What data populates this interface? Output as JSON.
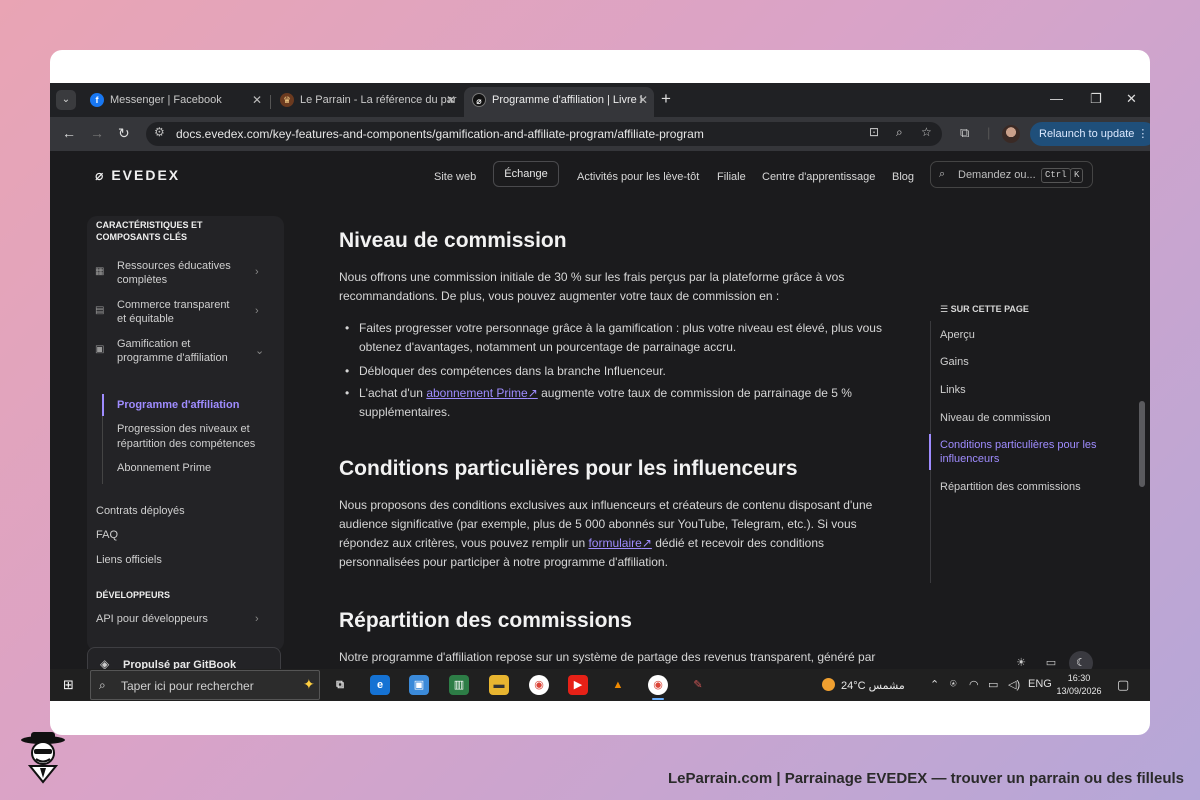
{
  "browser": {
    "tabs": [
      {
        "label": "Messenger | Facebook",
        "favicon": "facebook-icon"
      },
      {
        "label": "Le Parrain - La référence du par",
        "favicon": "leparrain-icon"
      },
      {
        "label": "Programme d'affiliation | Livre l",
        "favicon": "evedex-icon"
      }
    ],
    "url": "docs.evedex.com/key-features-and-components/gamification-and-affiliate-program/affiliate-program",
    "relaunch_label": "Relaunch to update"
  },
  "site": {
    "logo": "EVEDEX",
    "nav": [
      "Site web",
      "Échange",
      "Activités pour les lève-tôt",
      "Filiale",
      "Centre d'apprentissage",
      "Blog"
    ],
    "search_placeholder": "Demandez ou...",
    "search_kbd": [
      "Ctrl",
      "K"
    ]
  },
  "sidebar": {
    "section1": "CARACTÉRISTIQUES ET COMPOSANTS CLÉS",
    "items": [
      "Ressources éducatives complètes",
      "Commerce transparent et équitable",
      "Gamification et programme d'affiliation"
    ],
    "sub_items": [
      "Programme d'affiliation",
      "Progression des niveaux et répartition des compétences",
      "Abonnement Prime"
    ],
    "plain": [
      "Contrats déployés",
      "FAQ",
      "Liens officiels"
    ],
    "section2": "DÉVELOPPEURS",
    "dev_items": [
      "API pour développeurs"
    ],
    "gitbook": "Propulsé par GitBook"
  },
  "content": {
    "h_commission": "Niveau de commission",
    "p_commission": "Nous offrons une commission initiale de 30 % sur les frais perçus par la plateforme grâce à vos recommandations. De plus, vous pouvez augmenter votre taux de commission en :",
    "bullet1": "Faites progresser votre personnage grâce à la gamification : plus votre niveau est élevé, plus vous obtenez d'avantages, notamment un pourcentage de parrainage accru.",
    "bullet2": "Débloquer des compétences dans la branche Influenceur.",
    "bullet3_pre": "L'achat d'un",
    "bullet3_link": "abonnement Prime",
    "bullet3_post": "augmente votre taux de commission de parrainage de 5 % supplémentaires.",
    "h_influencers": "Conditions particulières pour les influenceurs",
    "p_infl_pre": "Nous proposons des conditions exclusives aux influenceurs et créateurs de contenu disposant d'une audience significative (par exemple, plus de 5 000 abonnés sur YouTube, Telegram, etc.). Si vous répondez aux critères, vous pouvez remplir un",
    "p_infl_link": "formulaire",
    "p_infl_post": "dédié et recevoir des conditions personnalisées pour participer à notre programme d'affiliation.",
    "h_repartition": "Répartition des commissions",
    "p_repartition": "Notre programme d'affiliation repose sur un système de partage des revenus transparent, généré par chaque transaction effectuée sur la plateforme. Il est important de comprendre comment ces revenus sont générés et répartis entre l'utilisateur, les affiliés et la plateforme."
  },
  "toc": {
    "title": "SUR CETTE PAGE",
    "items": [
      "Aperçu",
      "Gains",
      "Links",
      "Niveau de commission",
      "Conditions particulières pour les influenceurs",
      "Répartition des commissions"
    ]
  },
  "taskbar": {
    "search_placeholder": "Taper ici pour rechercher",
    "weather": "24°C  مشمس",
    "lang": "ENG",
    "time": "16:30",
    "date": "13/09/2026"
  },
  "watermark": "LeParrain.com | Parrainage EVEDEX — trouver un parrain ou des filleuls",
  "colors": {
    "accent": "#9f8cff",
    "page_bg": "#1b1b1d",
    "relaunch": "#1f4f7a"
  }
}
